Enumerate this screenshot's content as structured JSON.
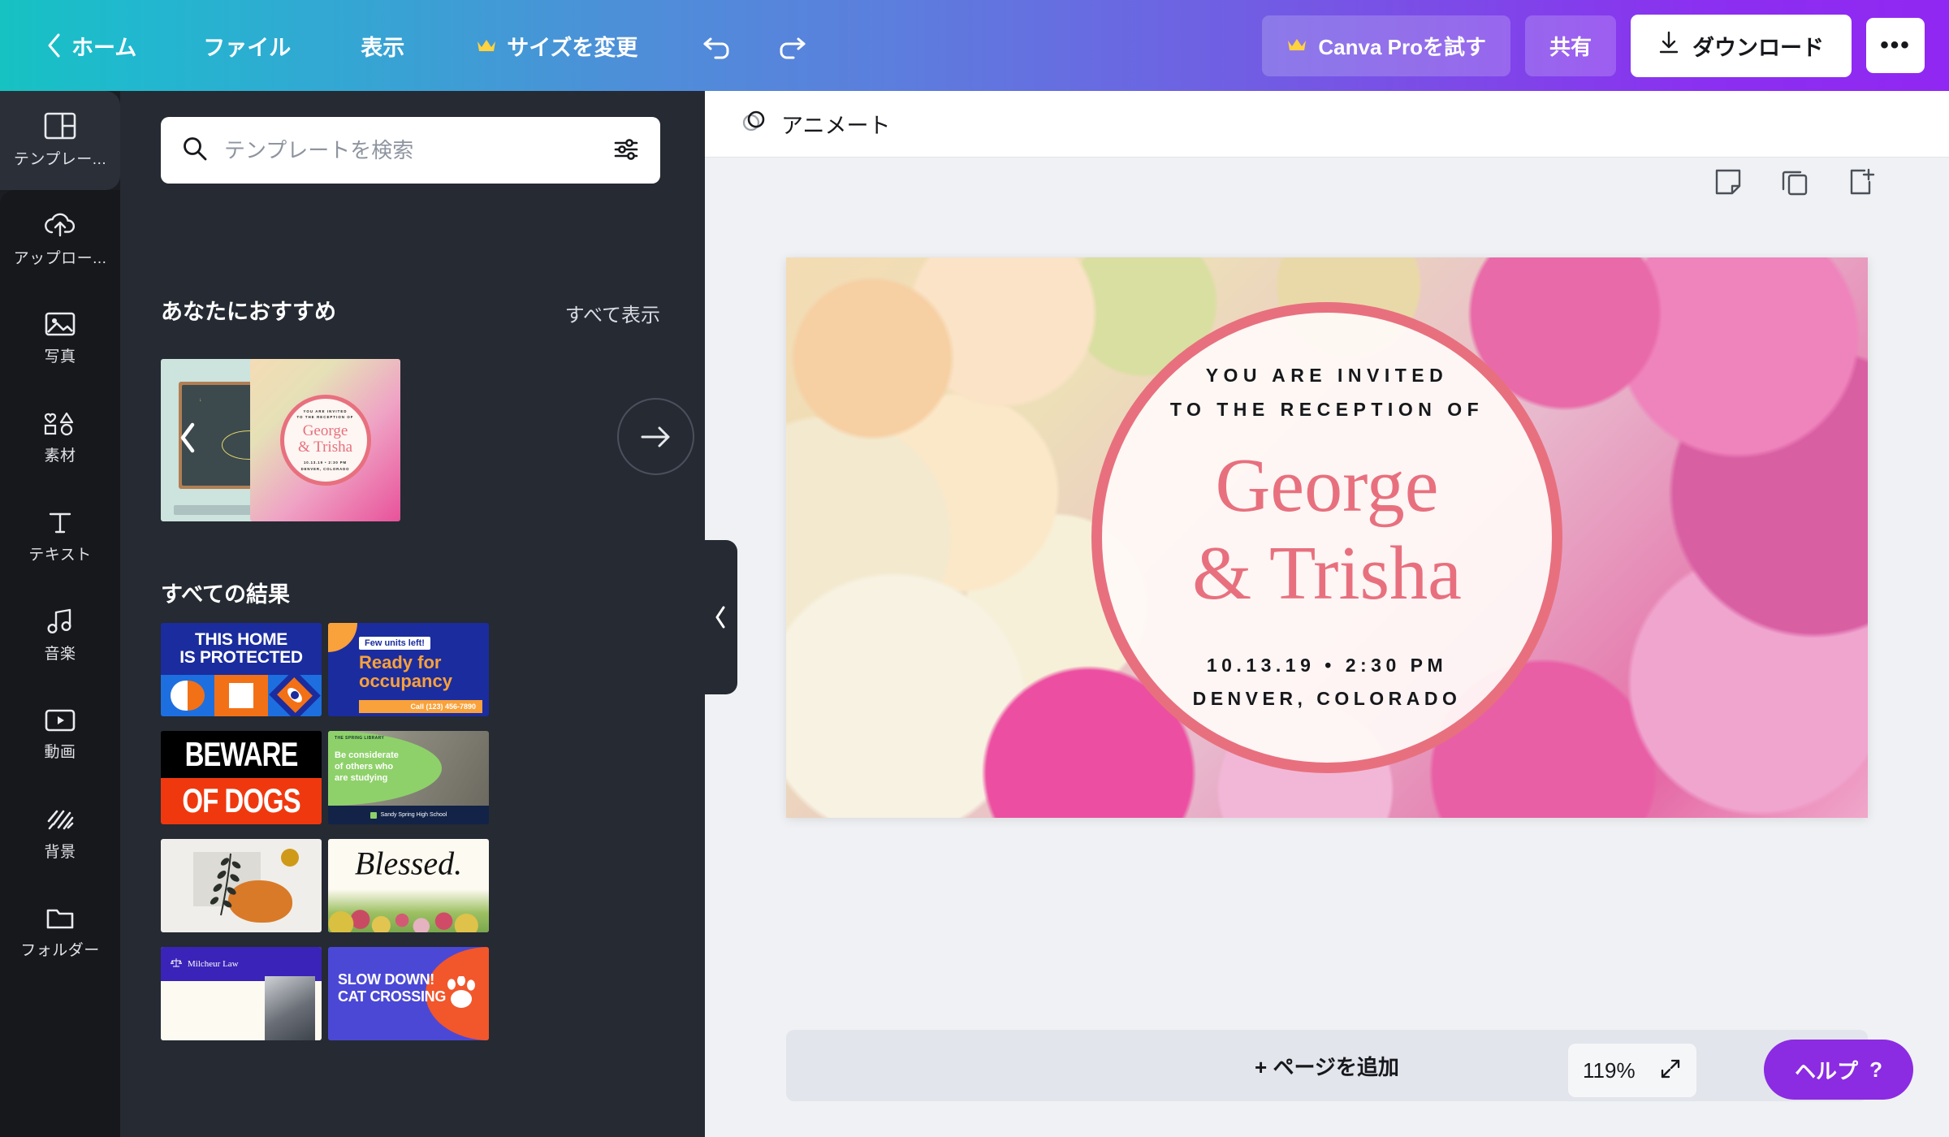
{
  "topbar": {
    "home": "ホーム",
    "file": "ファイル",
    "view": "表示",
    "resize": "サイズを変更",
    "undo_name": "undo",
    "redo_name": "redo",
    "try_pro": "Canva Proを試す",
    "share": "共有",
    "download": "ダウンロード",
    "more": "•••",
    "gradient_start": "#16c2c2",
    "gradient_end": "#9127f2"
  },
  "rail": {
    "items": [
      {
        "label": "テンプレー...",
        "icon": "templates-icon",
        "active": true
      },
      {
        "label": "アップロー...",
        "icon": "upload-icon",
        "active": false
      },
      {
        "label": "写真",
        "icon": "photo-icon",
        "active": false
      },
      {
        "label": "素材",
        "icon": "elements-icon",
        "active": false
      },
      {
        "label": "テキスト",
        "icon": "text-icon",
        "active": false
      },
      {
        "label": "音楽",
        "icon": "music-icon",
        "active": false
      },
      {
        "label": "動画",
        "icon": "video-icon",
        "active": false
      },
      {
        "label": "背景",
        "icon": "background-icon",
        "active": false
      },
      {
        "label": "フォルダー",
        "icon": "folder-icon",
        "active": false
      }
    ]
  },
  "panel": {
    "search_placeholder": "テンプレートを検索",
    "search_value": "",
    "recommended_title": "あなたにおすすめ",
    "see_all": "すべて表示",
    "all_results_title": "すべての結果",
    "recommended": [
      {
        "name": "chalkboard-quote-template"
      },
      {
        "name": "wedding-reception-invitation-template",
        "line1": "YOU ARE INVITED",
        "line2": "TO THE RECEPTION OF",
        "name1": "George",
        "name2": "& Trisha",
        "date": "10.13.19 • 2:30 PM",
        "place": "DENVER, COLORADO"
      }
    ],
    "results": [
      {
        "name": "this-home-is-protected",
        "l1": "THIS HOME",
        "l2": "IS PROTECTED"
      },
      {
        "name": "ready-for-occupancy",
        "badge": "Few units left!",
        "l1": "Ready for",
        "l2": "occupancy",
        "cta": "Call (123) 456-7890"
      },
      {
        "name": "beware-of-dogs",
        "l1": "BEWARE",
        "l2": "OF DOGS"
      },
      {
        "name": "library-be-considerate",
        "brand": "THE SPRING LIBRARY",
        "l1": "Be considerate",
        "l2": "of others who",
        "l3": "are studying",
        "footer": "Sandy Spring High School"
      },
      {
        "name": "abstract-plant-poster"
      },
      {
        "name": "blessed-floral-card",
        "l1": "Blessed."
      },
      {
        "name": "milcheur-law-card",
        "brand": "Milcheur Law"
      },
      {
        "name": "slow-down-cat-crossing",
        "l1": "SLOW DOWN!",
        "l2": "CAT CROSSING"
      }
    ]
  },
  "canvas": {
    "animate": "アニメート",
    "tools": [
      "notes-icon",
      "duplicate-page-icon",
      "add-page-icon"
    ],
    "design": {
      "invite_line1": "YOU ARE INVITED",
      "invite_line2": "TO THE RECEPTION OF",
      "name_first": "George",
      "name_second": "& Trisha",
      "date": "10.13.19 • 2:30 PM",
      "location": "DENVER, COLORADO",
      "accent_color": "#e8707e"
    },
    "add_page": "+ ページを追加",
    "zoom": "119%",
    "help": "ヘルプ",
    "help_mark": "?"
  }
}
